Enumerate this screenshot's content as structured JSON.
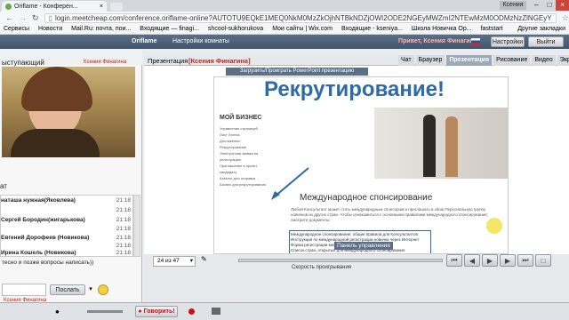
{
  "browser": {
    "tab_title": "Oriflame - Конферен...",
    "user_badge": "Ксения",
    "url": "login.meetcheap.com/conference,oriflame-online?AUTOTU9EQkE1MEQ0NkM0MzZkOjhNTBkNDZjOWI2ODE2NGEyMWZmI2NTEwMzM0ODMzNzZlNGEyY",
    "bookmarks": [
      "Сервисы",
      "Новости",
      "Mail.Ru: почта, пои...",
      "Входящие — finagi...",
      "shcool-sukhorukova",
      "Мои сайты | Wix.com",
      "Входящие - kseniya...",
      "Школа Новичка Ор...",
      "faststart",
      "Другие закладки"
    ]
  },
  "app": {
    "brand": "Oriflame",
    "settings_room": "Настройки комнаты",
    "greeting": "Привет, Ксения Финагина",
    "settings_btn": "Настройки",
    "exit_btn": "Выйти"
  },
  "speaker": {
    "label": "ыступающий",
    "name": "Ксения Финагина"
  },
  "chat": {
    "label": "ат",
    "messages": [
      {
        "user": "наташа нужная(Яковлева)",
        "time": "21:18"
      },
      {
        "user": "",
        "time": "21:18"
      },
      {
        "user": "Сергей Бородин(жигарькова)",
        "time": "21:18"
      },
      {
        "user": "",
        "time": "21:18"
      },
      {
        "user": "Евгений Дорофеев (Новикова)",
        "time": "21:18"
      },
      {
        "user": "",
        "time": "21:18"
      },
      {
        "user": "Ирина Кошель (Новикова)",
        "time": "21:18"
      }
    ],
    "footer_text": "тесно и позже вопросы написать))",
    "send_btn": "Послать"
  },
  "presentation": {
    "label": "Презентация",
    "presenter": "[Ксения Финагина]",
    "tabs": [
      "Чат",
      "Браузер",
      "Презентация",
      "Рисование",
      "Видео",
      "Экран"
    ],
    "active_tab": "Презентация",
    "upload_label": "Загрузить/Проиграть PowerPoint презентацию",
    "zoom": "24 из 47",
    "speed_label": "Скорость проигрывания",
    "control_panel": "Панель управления"
  },
  "slide": {
    "title": "Рекрутирование!",
    "section": "МОЙ БИЗНЕС",
    "menu": [
      "Управление страницей",
      "Лист Успеха",
      "Достижения",
      "Рекрутирование",
      "Электронная заявка на регистрацию",
      "Приглашение в проект кандидату",
      "Каталог для отправки",
      "Бизнес для рекрутирования"
    ],
    "subtitle": "Международное спонсирование",
    "body": "Любой Консультант может стать международным спонсором и приглашать в свою Персональную группу новичков из других стран. Чтобы ознакомиться с основными правилами международного спонсирования, смотрите документы:",
    "links": [
      "Международное спонсирование: общие правила для Консультантов",
      "Инструкция по международной регистрации новичка через Интернет",
      "Форма регистрации международного новичка",
      "Список стран, открытых для международного спонсирования"
    ]
  },
  "bottom": {
    "speaker": "Ксения Финагина",
    "talk_btn": "Говорить!"
  },
  "colors": {
    "title_blue": "#2e6aa6",
    "header_bg": "#4b5f75",
    "presenter_red": "#c02020",
    "talk_red": "#cc1111"
  }
}
